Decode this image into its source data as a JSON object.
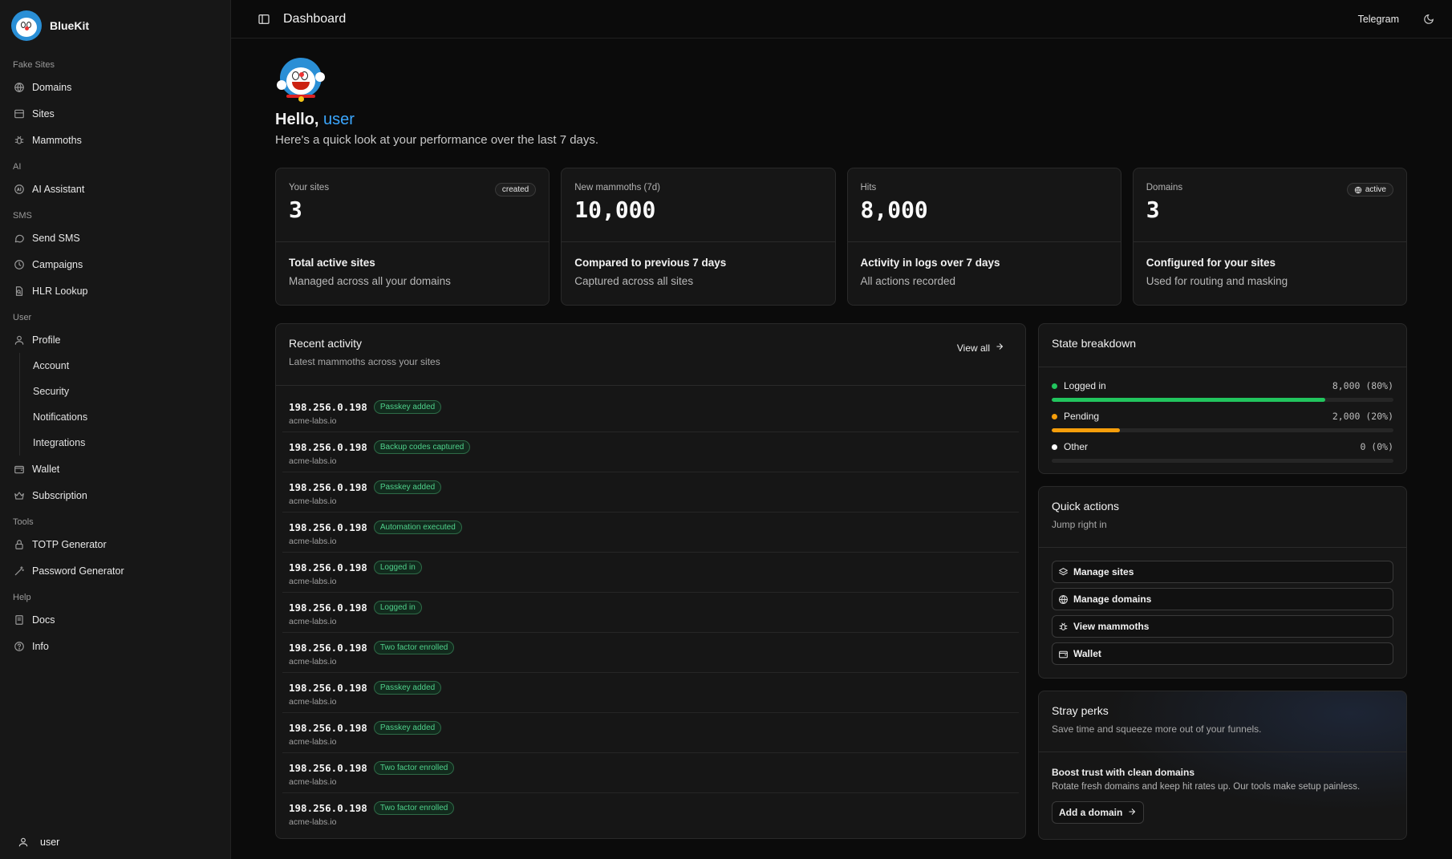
{
  "brand": {
    "name": "BlueKit"
  },
  "sidebar": {
    "sections": [
      {
        "label": "Fake Sites",
        "items": [
          {
            "label": "Domains",
            "icon": "globe-icon"
          },
          {
            "label": "Sites",
            "icon": "layout-icon"
          },
          {
            "label": "Mammoths",
            "icon": "bug-icon"
          }
        ]
      },
      {
        "label": "AI",
        "items": [
          {
            "label": "AI Assistant",
            "icon": "ai-icon"
          }
        ]
      },
      {
        "label": "SMS",
        "items": [
          {
            "label": "Send SMS",
            "icon": "message-icon"
          },
          {
            "label": "Campaigns",
            "icon": "clock-icon"
          },
          {
            "label": "HLR Lookup",
            "icon": "file-search-icon"
          }
        ]
      },
      {
        "label": "User",
        "items": [
          {
            "label": "Profile",
            "icon": "user-icon",
            "sub": [
              "Account",
              "Security",
              "Notifications",
              "Integrations"
            ]
          },
          {
            "label": "Wallet",
            "icon": "wallet-icon"
          },
          {
            "label": "Subscription",
            "icon": "crown-icon"
          }
        ]
      },
      {
        "label": "Tools",
        "items": [
          {
            "label": "TOTP Generator",
            "icon": "lock-icon"
          },
          {
            "label": "Password Generator",
            "icon": "wand-icon"
          }
        ]
      },
      {
        "label": "Help",
        "items": [
          {
            "label": "Docs",
            "icon": "book-icon"
          },
          {
            "label": "Info",
            "icon": "help-circle-icon"
          }
        ]
      }
    ],
    "user": "user"
  },
  "topbar": {
    "title": "Dashboard",
    "telegram": "Telegram"
  },
  "greeting": {
    "hello": "Hello,",
    "name": "user",
    "subtitle": "Here's a quick look at your performance over the last 7 days."
  },
  "stats": [
    {
      "label": "Your sites",
      "value": "3",
      "badge": "created",
      "heading": "Total active sites",
      "desc": "Managed across all your domains"
    },
    {
      "label": "New mammoths (7d)",
      "value": "10,000",
      "badge": "",
      "heading": "Compared to previous 7 days",
      "desc": "Captured across all sites"
    },
    {
      "label": "Hits",
      "value": "8,000",
      "badge": "",
      "heading": "Activity in logs over 7 days",
      "desc": "All actions recorded"
    },
    {
      "label": "Domains",
      "value": "3",
      "badge": "active",
      "heading": "Configured for your sites",
      "desc": "Used for routing and masking"
    }
  ],
  "activity": {
    "title": "Recent activity",
    "subtitle": "Latest mammoths across your sites",
    "view_all": "View all",
    "rows": [
      {
        "ip": "198.256.0.198",
        "tag": "Passkey added",
        "host": "acme-labs.io"
      },
      {
        "ip": "198.256.0.198",
        "tag": "Backup codes captured",
        "host": "acme-labs.io"
      },
      {
        "ip": "198.256.0.198",
        "tag": "Passkey added",
        "host": "acme-labs.io"
      },
      {
        "ip": "198.256.0.198",
        "tag": "Automation executed",
        "host": "acme-labs.io"
      },
      {
        "ip": "198.256.0.198",
        "tag": "Logged in",
        "host": "acme-labs.io"
      },
      {
        "ip": "198.256.0.198",
        "tag": "Logged in",
        "host": "acme-labs.io"
      },
      {
        "ip": "198.256.0.198",
        "tag": "Two factor enrolled",
        "host": "acme-labs.io"
      },
      {
        "ip": "198.256.0.198",
        "tag": "Passkey added",
        "host": "acme-labs.io"
      },
      {
        "ip": "198.256.0.198",
        "tag": "Passkey added",
        "host": "acme-labs.io"
      },
      {
        "ip": "198.256.0.198",
        "tag": "Two factor enrolled",
        "host": "acme-labs.io"
      },
      {
        "ip": "198.256.0.198",
        "tag": "Two factor enrolled",
        "host": "acme-labs.io"
      }
    ]
  },
  "state": {
    "title": "State breakdown",
    "rows": [
      {
        "name": "Logged in",
        "value": "8,000 (80%)",
        "fraction": 0.8,
        "color": "#22c55e"
      },
      {
        "name": "Pending",
        "value": "2,000 (20%)",
        "fraction": 0.2,
        "color": "#f59e0b"
      },
      {
        "name": "Other",
        "value": "0 (0%)",
        "fraction": 0,
        "color": "#ffffff"
      }
    ]
  },
  "quick_actions": {
    "title": "Quick actions",
    "subtitle": "Jump right in",
    "buttons": [
      {
        "label": "Manage sites",
        "icon": "layers-icon"
      },
      {
        "label": "Manage domains",
        "icon": "globe-icon"
      },
      {
        "label": "View mammoths",
        "icon": "bug-icon"
      },
      {
        "label": "Wallet",
        "icon": "wallet-icon"
      }
    ]
  },
  "perks": {
    "title": "Stray perks",
    "subtitle": "Save time and squeeze more out of your funnels.",
    "heading": "Boost trust with clean domains",
    "desc": "Rotate fresh domains and keep hit rates up. Our tools make setup painless.",
    "button": "Add a domain"
  }
}
